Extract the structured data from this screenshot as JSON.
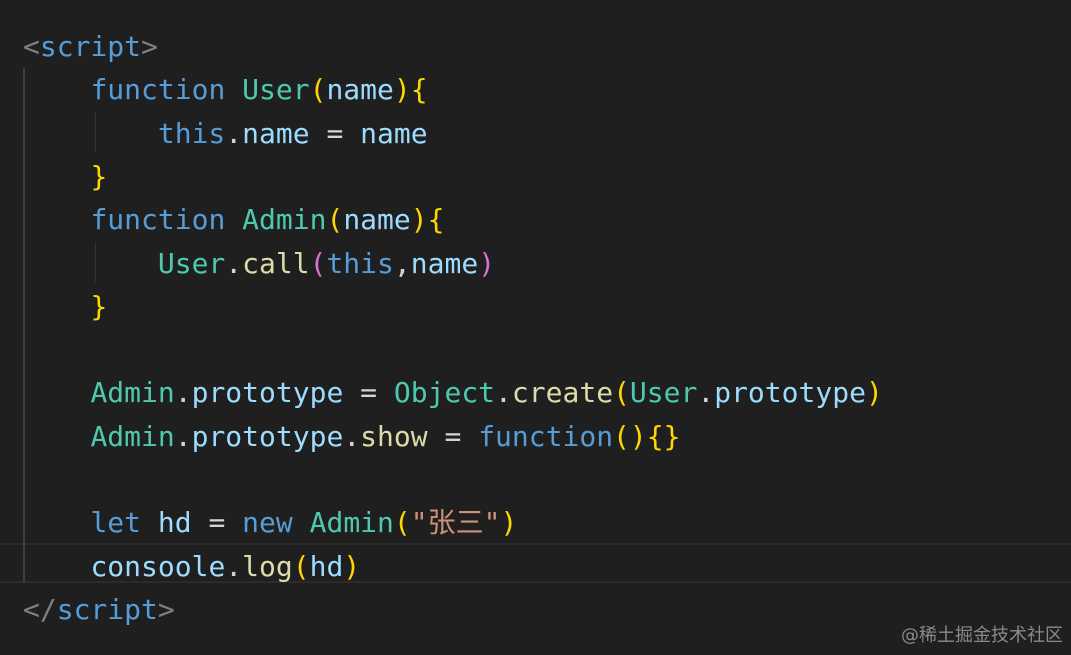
{
  "colors": {
    "background": "#1f1f1f",
    "tag_bracket": "#808080",
    "tag_name": "#569cd6",
    "keyword": "#569cd6",
    "function_name": "#dcdcaa",
    "class_name": "#4ec9b0",
    "variable": "#9cdcfe",
    "plain": "#d4d4d4",
    "string": "#ce9178",
    "bracket_gold": "#ffd700",
    "bracket_purple": "#da70d6",
    "bracket_blue": "#179fff"
  },
  "code": {
    "lines": [
      [
        {
          "t": "<",
          "c": "tag_bracket"
        },
        {
          "t": "script",
          "c": "tag_name"
        },
        {
          "t": ">",
          "c": "tag_bracket"
        }
      ],
      [
        {
          "t": "    ",
          "c": "plain"
        },
        {
          "t": "function",
          "c": "keyword"
        },
        {
          "t": " ",
          "c": "plain"
        },
        {
          "t": "User",
          "c": "class_name"
        },
        {
          "t": "(",
          "c": "bracket_gold"
        },
        {
          "t": "name",
          "c": "variable"
        },
        {
          "t": ")",
          "c": "bracket_gold"
        },
        {
          "t": "{",
          "c": "bracket_gold"
        }
      ],
      [
        {
          "t": "        ",
          "c": "plain"
        },
        {
          "t": "this",
          "c": "keyword"
        },
        {
          "t": ".",
          "c": "plain"
        },
        {
          "t": "name",
          "c": "variable"
        },
        {
          "t": " = ",
          "c": "plain"
        },
        {
          "t": "name",
          "c": "variable"
        }
      ],
      [
        {
          "t": "    ",
          "c": "plain"
        },
        {
          "t": "}",
          "c": "bracket_gold"
        }
      ],
      [
        {
          "t": "    ",
          "c": "plain"
        },
        {
          "t": "function",
          "c": "keyword"
        },
        {
          "t": " ",
          "c": "plain"
        },
        {
          "t": "Admin",
          "c": "class_name"
        },
        {
          "t": "(",
          "c": "bracket_gold"
        },
        {
          "t": "name",
          "c": "variable"
        },
        {
          "t": ")",
          "c": "bracket_gold"
        },
        {
          "t": "{",
          "c": "bracket_gold"
        }
      ],
      [
        {
          "t": "        ",
          "c": "plain"
        },
        {
          "t": "User",
          "c": "class_name"
        },
        {
          "t": ".",
          "c": "plain"
        },
        {
          "t": "call",
          "c": "function_name"
        },
        {
          "t": "(",
          "c": "bracket_purple"
        },
        {
          "t": "this",
          "c": "keyword"
        },
        {
          "t": ",",
          "c": "plain"
        },
        {
          "t": "name",
          "c": "variable"
        },
        {
          "t": ")",
          "c": "bracket_purple"
        }
      ],
      [
        {
          "t": "    ",
          "c": "plain"
        },
        {
          "t": "}",
          "c": "bracket_gold"
        }
      ],
      [],
      [
        {
          "t": "    ",
          "c": "plain"
        },
        {
          "t": "Admin",
          "c": "class_name"
        },
        {
          "t": ".",
          "c": "plain"
        },
        {
          "t": "prototype",
          "c": "variable"
        },
        {
          "t": " = ",
          "c": "plain"
        },
        {
          "t": "Object",
          "c": "class_name"
        },
        {
          "t": ".",
          "c": "plain"
        },
        {
          "t": "create",
          "c": "function_name"
        },
        {
          "t": "(",
          "c": "bracket_gold"
        },
        {
          "t": "User",
          "c": "class_name"
        },
        {
          "t": ".",
          "c": "plain"
        },
        {
          "t": "prototype",
          "c": "variable"
        },
        {
          "t": ")",
          "c": "bracket_gold"
        }
      ],
      [
        {
          "t": "    ",
          "c": "plain"
        },
        {
          "t": "Admin",
          "c": "class_name"
        },
        {
          "t": ".",
          "c": "plain"
        },
        {
          "t": "prototype",
          "c": "variable"
        },
        {
          "t": ".",
          "c": "plain"
        },
        {
          "t": "show",
          "c": "function_name"
        },
        {
          "t": " = ",
          "c": "plain"
        },
        {
          "t": "function",
          "c": "keyword"
        },
        {
          "t": "()",
          "c": "bracket_gold"
        },
        {
          "t": "{}",
          "c": "bracket_gold"
        }
      ],
      [],
      [
        {
          "t": "    ",
          "c": "plain"
        },
        {
          "t": "let",
          "c": "keyword"
        },
        {
          "t": " ",
          "c": "plain"
        },
        {
          "t": "hd",
          "c": "variable"
        },
        {
          "t": " = ",
          "c": "plain"
        },
        {
          "t": "new",
          "c": "keyword"
        },
        {
          "t": " ",
          "c": "plain"
        },
        {
          "t": "Admin",
          "c": "class_name"
        },
        {
          "t": "(",
          "c": "bracket_gold"
        },
        {
          "t": "\"张三\"",
          "c": "string"
        },
        {
          "t": ")",
          "c": "bracket_gold"
        }
      ],
      [
        {
          "t": "    ",
          "c": "plain"
        },
        {
          "t": "consoole",
          "c": "variable"
        },
        {
          "t": ".",
          "c": "plain"
        },
        {
          "t": "log",
          "c": "function_name"
        },
        {
          "t": "(",
          "c": "bracket_gold"
        },
        {
          "t": "hd",
          "c": "variable"
        },
        {
          "t": ")",
          "c": "bracket_gold"
        }
      ],
      [
        {
          "t": "</",
          "c": "tag_bracket"
        },
        {
          "t": "script",
          "c": "tag_name"
        },
        {
          "t": ">",
          "c": "tag_bracket"
        }
      ]
    ]
  },
  "watermark": "@稀土掘金技术社区"
}
